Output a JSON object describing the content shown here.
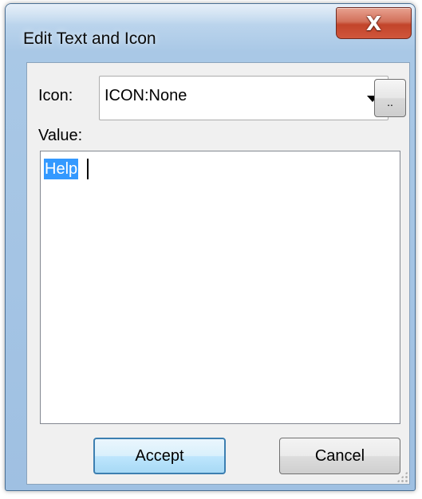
{
  "window": {
    "title": "Edit Text and Icon",
    "close_label": "X"
  },
  "form": {
    "icon_label": "Icon:",
    "icon_value": "ICON:None",
    "browse_label": "..",
    "value_label": "Value:",
    "value_text": "Help"
  },
  "buttons": {
    "accept_label": "Accept",
    "cancel_label": "Cancel"
  },
  "colors": {
    "selection": "#3399ff",
    "close_button": "#c2442a",
    "default_button_border": "#3c7fb1"
  }
}
